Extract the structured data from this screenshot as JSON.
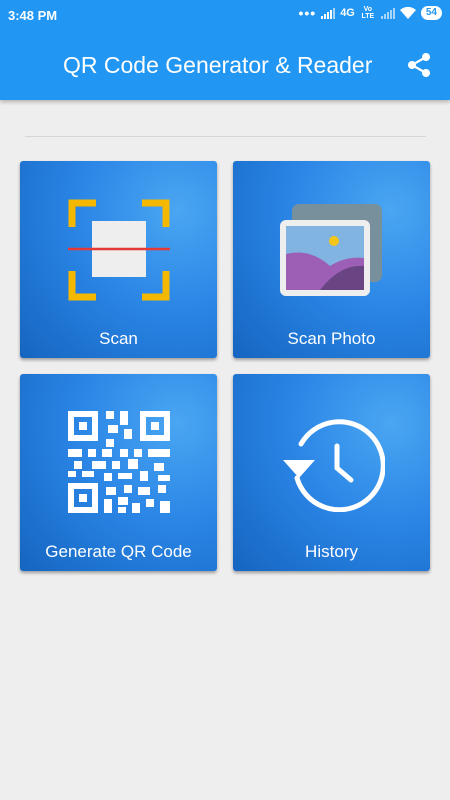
{
  "status_bar": {
    "time": "3:48 PM",
    "network": "4G",
    "volte": "Vo LTE",
    "battery": "54"
  },
  "app_bar": {
    "title": "QR Code Generator & Reader",
    "share_icon": "share-icon"
  },
  "tiles": [
    {
      "label": "Scan",
      "icon": "scan-icon"
    },
    {
      "label": "Scan Photo",
      "icon": "photo-icon"
    },
    {
      "label": "Generate QR Code",
      "icon": "qr-code-icon"
    },
    {
      "label": "History",
      "icon": "history-icon"
    }
  ],
  "colors": {
    "primary": "#2196f3",
    "tile_dark": "#1565c0",
    "tile_light": "#4aa6f2",
    "scan_corner": "#f5b800",
    "scan_line": "#e53935",
    "photo_purple": "#9c5fb5",
    "photo_sky": "#81b4e0",
    "photo_sun": "#f5c518",
    "background": "#eeeeee"
  }
}
